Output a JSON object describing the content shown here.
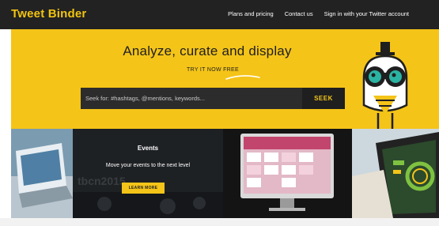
{
  "header": {
    "brand": "Tweet Binder",
    "nav": [
      "Plans and pricing",
      "Contact us",
      "Sign in with your Twitter account"
    ]
  },
  "hero": {
    "title": "Analyze, curate and display",
    "cta_text": "TRY IT NOW FREE",
    "search_placeholder": "Seek for: #hashtags, @mentions, keywords...",
    "search_button": "SEEK"
  },
  "panels": {
    "events": {
      "title": "Events",
      "subtitle": "Move your events to the next level",
      "button": "LEARN MORE",
      "background_text": "tbcn2015"
    }
  },
  "colors": {
    "brand_yellow": "#f4c418",
    "dark": "#222222"
  },
  "icons": [
    "binoculars-mascot-icon",
    "swoosh-icon"
  ]
}
